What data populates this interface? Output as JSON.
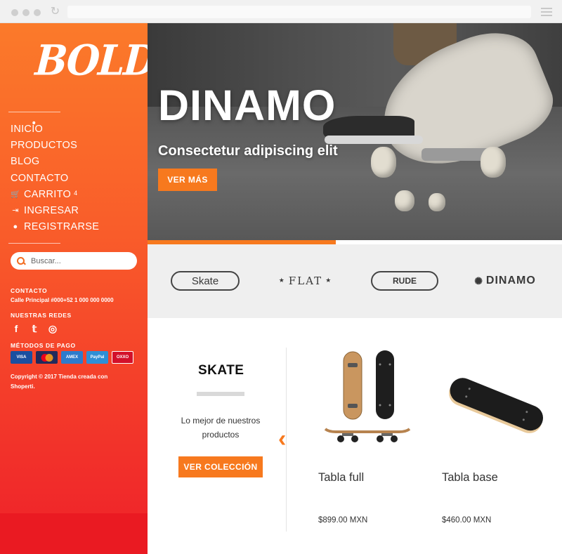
{
  "brand": {
    "logo_text": "BOLD"
  },
  "nav": [
    {
      "label": "INICIO",
      "icon": ""
    },
    {
      "label": "PRODUCTOS",
      "icon": ""
    },
    {
      "label": "BLOG",
      "icon": ""
    },
    {
      "label": "CONTACTO",
      "icon": ""
    },
    {
      "label": "CARRITO",
      "icon": "cart-icon",
      "badge": "4"
    },
    {
      "label": "INGRESAR",
      "icon": "login-icon"
    },
    {
      "label": "REGISTRARSE",
      "icon": "user-icon"
    }
  ],
  "search": {
    "placeholder": "Buscar..."
  },
  "contact": {
    "heading": "CONTACTO",
    "text": "Calle Principal #000+52 1 000 000 0000"
  },
  "social": {
    "heading": "NUESTRAS REDES",
    "icons": [
      "facebook-icon",
      "twitter-icon",
      "instagram-icon"
    ]
  },
  "payment": {
    "heading": "MÉTODOS DE PAGO",
    "methods": [
      {
        "label": "VISA",
        "color": "#1a4fa0"
      },
      {
        "label": "MC",
        "color": "#222a5b"
      },
      {
        "label": "AMEX",
        "color": "#2d7bcc"
      },
      {
        "label": "PayPal",
        "color": "#2f8fd6"
      },
      {
        "label": "OXXO",
        "color": "#d3102a"
      }
    ]
  },
  "copyright": "Copyright © 2017 Tienda creada con Shoperti.",
  "hero": {
    "title": "DINAMO",
    "subtitle": "Consectetur adipiscing elit",
    "button": "VER MÁS",
    "progress": 0.455
  },
  "brands": [
    "Skate",
    "FLAT",
    "RUDE",
    "DINAMO"
  ],
  "collection": {
    "title": "SKATE",
    "description": "Lo mejor de nuestros productos",
    "button": "VER COLECCIÓN"
  },
  "products": [
    {
      "name": "Tabla full",
      "price": "$899.00 MXN"
    },
    {
      "name": "Tabla base",
      "price": "$460.00 MXN"
    }
  ],
  "colors": {
    "accent": "#f7791e",
    "sidebar_top": "#fb7a2a",
    "sidebar_bottom": "#ef2129"
  }
}
